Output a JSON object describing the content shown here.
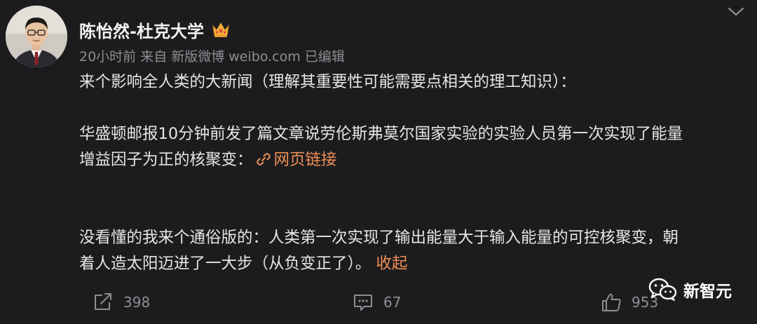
{
  "author": {
    "name": "陈怡然-杜克大学",
    "badge_icon": "crown-icon"
  },
  "meta": {
    "time": "20小时前",
    "source": "来自 新版微博 weibo.com",
    "edited": "已编辑"
  },
  "content": {
    "line1": "来个影响全人类的大新闻（理解其重要性可能需要点相关的理工知识）：",
    "line2": "华盛顿邮报10分钟前发了篇文章说劳伦斯弗莫尔国家实验的实验人员第一次实现了能量",
    "line3": "增益因子为正的核聚变：",
    "link_label": "网页链接",
    "line4": "没看懂的我来个通俗版的：人类第一次实现了输出能量大于输入能量的可控核聚变，朝",
    "line5": "着人造太阳迈进了一大步（从负变正了）。",
    "collapse_label": "收起"
  },
  "actions": {
    "repost_count": "398",
    "comment_count": "67",
    "like_count": "953"
  },
  "watermark": {
    "text": "新智元"
  },
  "colors": {
    "background": "#1c1c1e",
    "link": "#ef8e56",
    "muted": "#8e8e93"
  }
}
